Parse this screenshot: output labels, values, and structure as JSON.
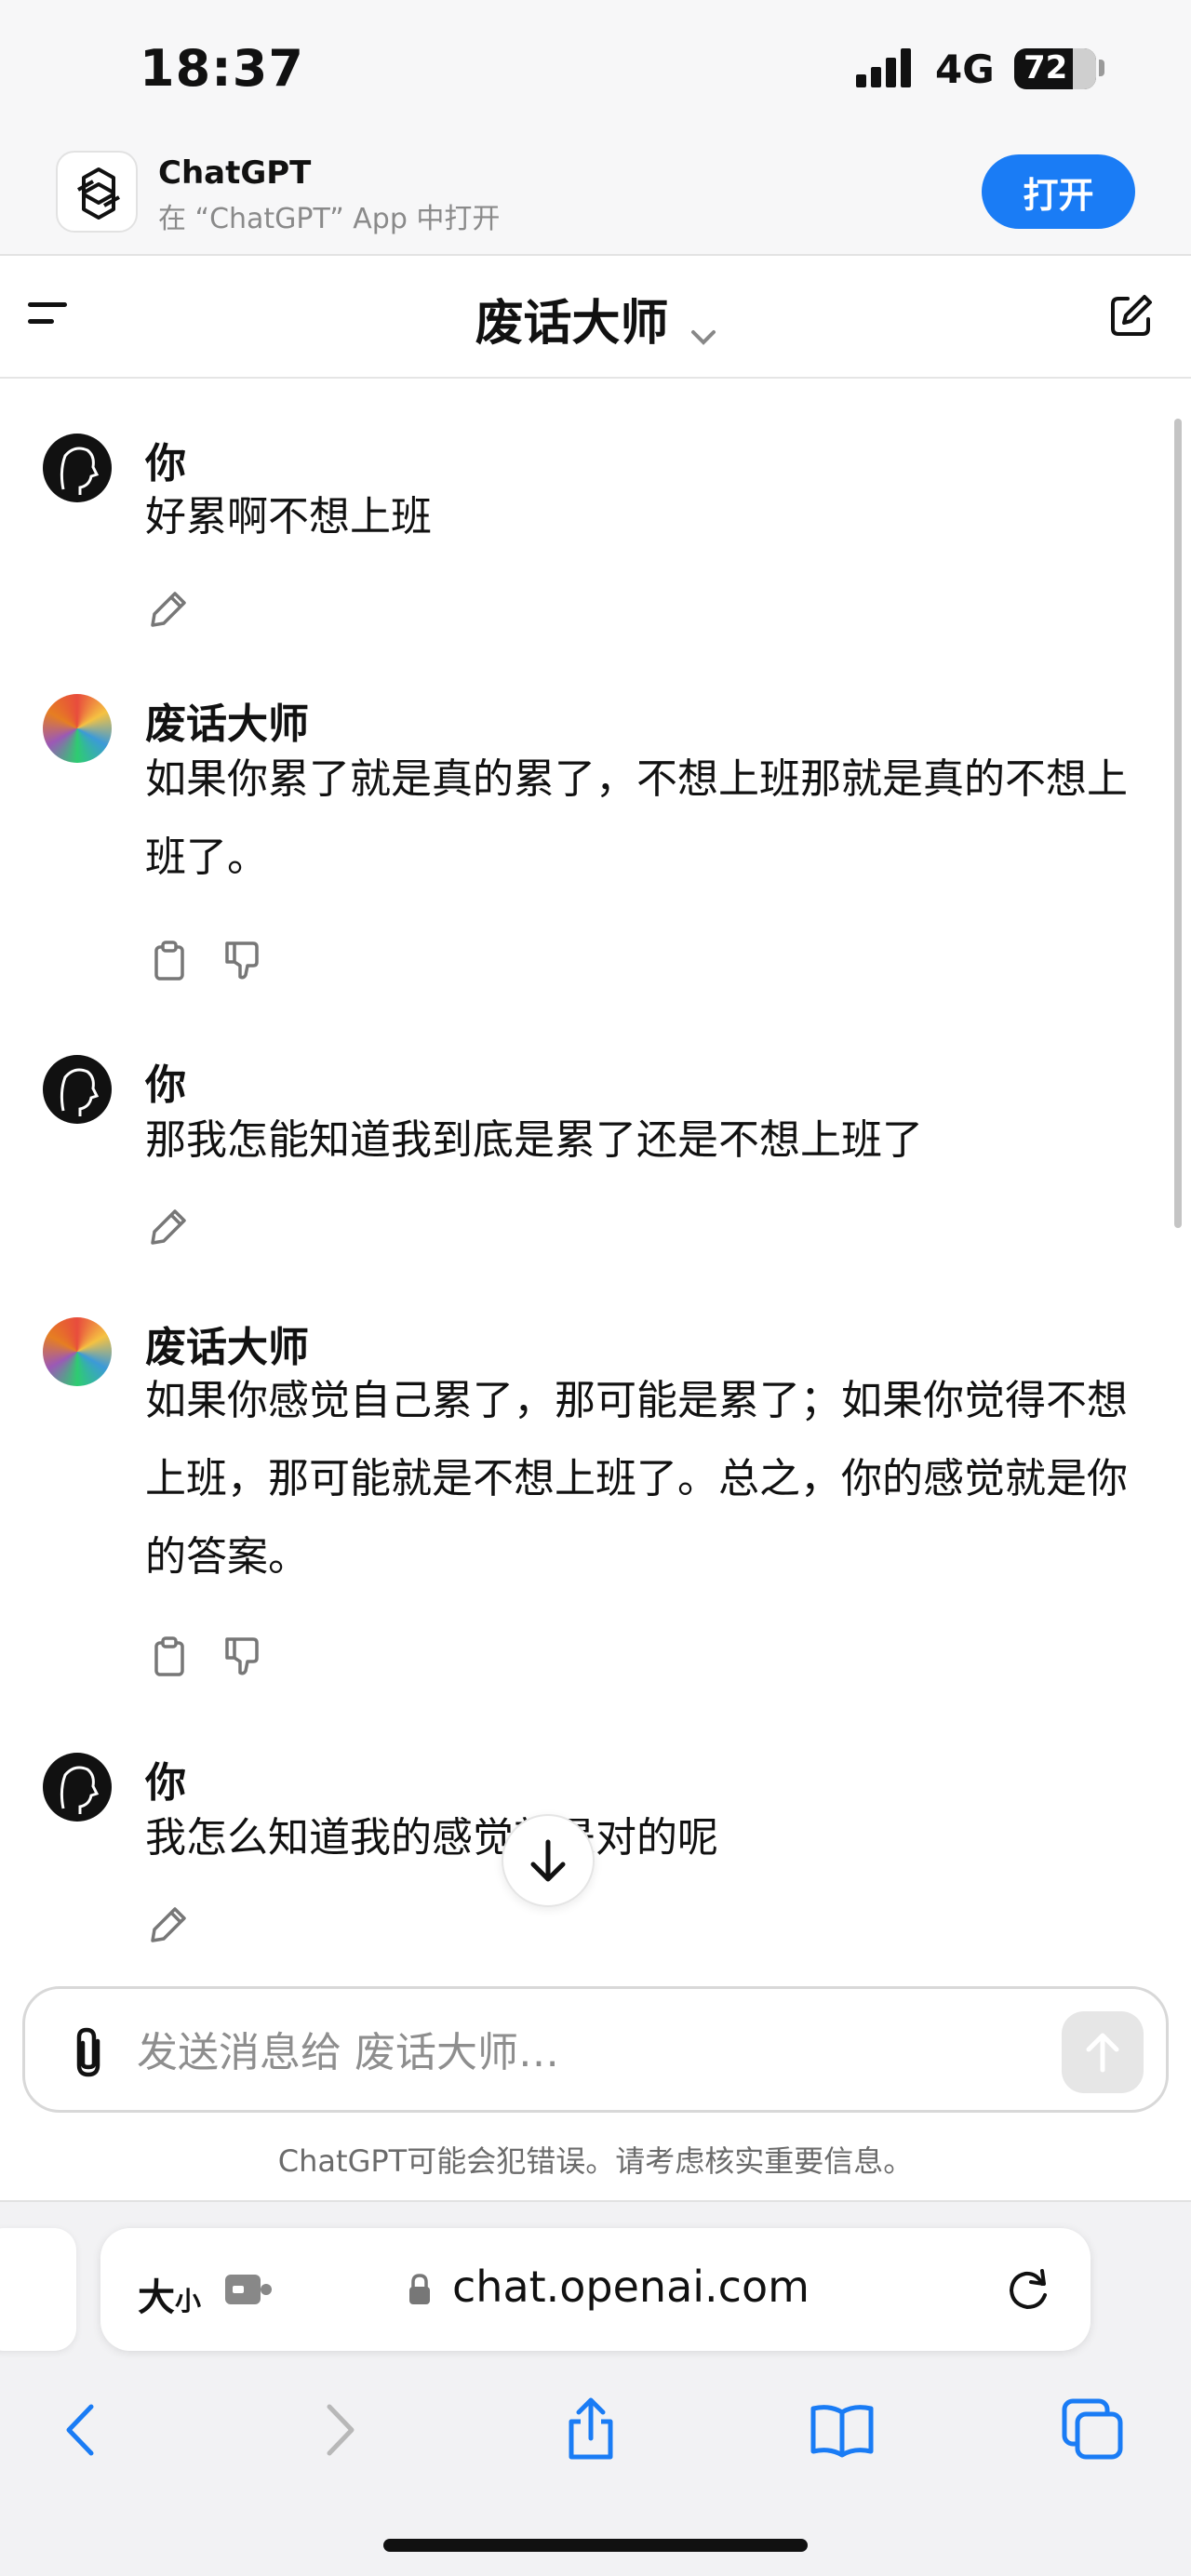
{
  "status_bar": {
    "time": "18:37",
    "network": "4G",
    "battery": "72",
    "battery_level": 0.72
  },
  "app_banner": {
    "name": "ChatGPT",
    "subtitle": "在 “ChatGPT” App 中打开",
    "open_label": "打开"
  },
  "header": {
    "title": "废话大师"
  },
  "messages": [
    {
      "sender": "你",
      "text": "好累啊不想上班"
    },
    {
      "sender": "废话大师",
      "text": "如果你累了就是真的累了，不想上班那就是真的不想上班了。"
    },
    {
      "sender": "你",
      "text": "那我怎能知道我到底是累了还是不想上班了"
    },
    {
      "sender": "废话大师",
      "text": "如果你感觉自己累了，那可能是累了；如果你觉得不想上班，那可能就是不想上班了。总之，你的感觉就是你的答案。"
    },
    {
      "sender": "你",
      "text": "我怎么知道我的感觉就是对的呢"
    }
  ],
  "composer": {
    "placeholder": "发送消息给 废话大师…",
    "value": ""
  },
  "disclaimer": "ChatGPT可能会犯错误。请考虑核实重要信息。",
  "browser": {
    "size_label": "大",
    "size_label_small": "小",
    "url": "chat.openai.com"
  },
  "icons": {
    "menu": "menu-icon",
    "compose": "new-chat-icon",
    "edit": "pencil-icon",
    "copy": "clipboard-icon",
    "dislike": "thumbs-down-icon",
    "attach": "paperclip-icon",
    "send": "arrow-up-icon",
    "scroll": "arrow-down-icon",
    "lock": "lock-icon",
    "reload": "reload-icon",
    "back": "chevron-left-icon",
    "forward": "chevron-right-icon",
    "share": "share-icon",
    "bookmarks": "book-icon",
    "tabs": "tabs-icon"
  },
  "colors": {
    "accent": "#1a7cf5",
    "text": "#111111",
    "muted": "#8e8e8e"
  }
}
